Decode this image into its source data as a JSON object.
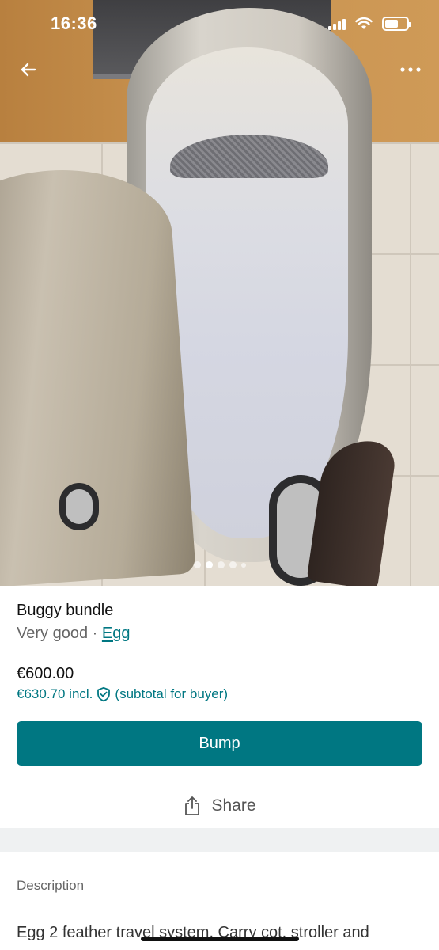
{
  "status_bar": {
    "time": "16:36"
  },
  "listing": {
    "title": "Buggy bundle",
    "condition": "Very good",
    "separator": "·",
    "brand": "Egg",
    "price": "€600.00",
    "price_incl": "€630.70 incl.",
    "price_incl_note": "(subtotal for buyer)"
  },
  "photos": {
    "count": 5,
    "active_index": 1
  },
  "actions": {
    "bump_label": "Bump",
    "share_label": "Share"
  },
  "description": {
    "label": "Description",
    "text": "Egg 2  feather travel system. Carry cot, stroller and"
  },
  "colors": {
    "accent": "#007782",
    "section_gap": "#eff1f2"
  },
  "icons": {
    "back": "arrow-left-icon",
    "more": "more-horizontal-icon",
    "share": "share-icon",
    "shield": "shield-check-icon"
  }
}
